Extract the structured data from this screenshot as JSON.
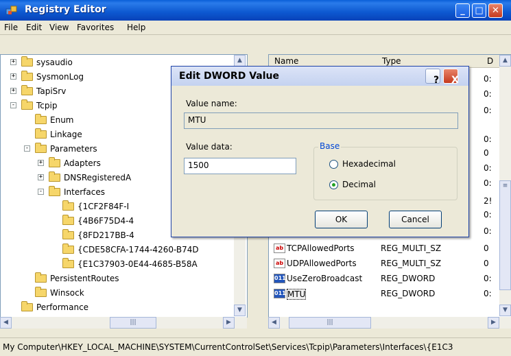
{
  "window": {
    "title": "Registry Editor"
  },
  "menu": [
    "File",
    "Edit",
    "View",
    "Favorites",
    "Help"
  ],
  "tree": [
    {
      "label": "sysaudio",
      "level": 0,
      "expander": "+"
    },
    {
      "label": "SysmonLog",
      "level": 0,
      "expander": "+"
    },
    {
      "label": "TapiSrv",
      "level": 0,
      "expander": "+"
    },
    {
      "label": "Tcpip",
      "level": 0,
      "expander": "-"
    },
    {
      "label": "Enum",
      "level": 1,
      "expander": ""
    },
    {
      "label": "Linkage",
      "level": 1,
      "expander": ""
    },
    {
      "label": "Parameters",
      "level": 1,
      "expander": "-"
    },
    {
      "label": "Adapters",
      "level": 2,
      "expander": "+"
    },
    {
      "label": "DNSRegisteredA",
      "level": 2,
      "expander": "+"
    },
    {
      "label": "Interfaces",
      "level": 2,
      "expander": "-"
    },
    {
      "label": "{1CF2F84F-I",
      "level": 3,
      "expander": ""
    },
    {
      "label": "{4B6F75D4-4",
      "level": 3,
      "expander": ""
    },
    {
      "label": "{8FD217BB-4",
      "level": 3,
      "expander": ""
    },
    {
      "label": "{CDE58CFA-1744-4260-B74D",
      "level": 3,
      "expander": ""
    },
    {
      "label": "{E1C37903-0E44-4685-B58A",
      "level": 3,
      "expander": ""
    },
    {
      "label": "PersistentRoutes",
      "level": 1,
      "expander": ""
    },
    {
      "label": "Winsock",
      "level": 1,
      "expander": ""
    },
    {
      "label": "Performance",
      "level": 0,
      "expander": ""
    }
  ],
  "list": {
    "columns": [
      "Name",
      "Type",
      "D"
    ],
    "rows": [
      {
        "name": "TCPAllowedPorts",
        "type": "REG_MULTI_SZ",
        "data": "0",
        "icon": "ab"
      },
      {
        "name": "UDPAllowedPorts",
        "type": "REG_MULTI_SZ",
        "data": "0",
        "icon": "ab"
      },
      {
        "name": "UseZeroBroadcast",
        "type": "REG_DWORD",
        "data": "0:",
        "icon": "011"
      },
      {
        "name": "MTU",
        "type": "REG_DWORD",
        "data": "0:",
        "icon": "011"
      }
    ],
    "partial_data": [
      "0:",
      "0:",
      "0:",
      "0:",
      "0",
      "0:",
      "0:",
      "2!",
      "0:",
      "0:"
    ]
  },
  "dialog": {
    "title": "Edit DWORD Value",
    "value_name_label": "Value name:",
    "value_name": "MTU",
    "value_data_label": "Value data:",
    "value_data": "1500",
    "base_label": "Base",
    "hex_label": "Hexadecimal",
    "dec_label": "Decimal",
    "ok": "OK",
    "cancel": "Cancel",
    "help_btn": "?",
    "close_btn": "X"
  },
  "status": "My Computer\\HKEY_LOCAL_MACHINE\\SYSTEM\\CurrentControlSet\\Services\\Tcpip\\Parameters\\Interfaces\\{E1C3"
}
